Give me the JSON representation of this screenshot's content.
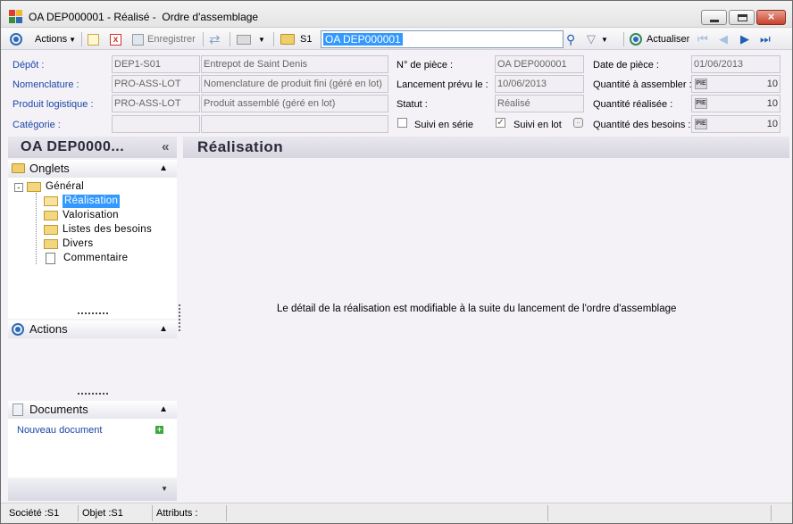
{
  "window": {
    "title": "OA DEP000001 - Réalisé -  Ordre d'assemblage",
    "close_glyph": "×"
  },
  "toolbar": {
    "actions_label": "Actions",
    "save_label": "Enregistrer",
    "s1_label": "S1",
    "search_value": "OA DEP000001",
    "refresh_label": "Actualiser"
  },
  "header": {
    "depot_label": "Dépôt :",
    "depot_code": "DEP1-S01",
    "depot_name": "Entrepot de  Saint  Denis",
    "nomenclature_label": "Nomenclature :",
    "nomenclature_code": "PRO-ASS-LOT",
    "nomenclature_name": "Nomenclature de produit fini (géré en lot)",
    "produit_label": "Produit logistique :",
    "produit_code": "PRO-ASS-LOT",
    "produit_name": "Produit assemblé (géré en lot)",
    "categorie_label": "Catégorie :",
    "categorie_code": "",
    "categorie_name": "",
    "piece_label": "N° de pièce :",
    "piece_value": "OA DEP000001",
    "lancement_label": "Lancement prévu le :",
    "lancement_value": "10/06/2013",
    "statut_label": "Statut :",
    "statut_value": "Réalisé",
    "suivi_serie_label": "Suivi en série",
    "suivi_lot_label": "Suivi en lot",
    "date_piece_label": "Date de pièce :",
    "date_piece_value": "01/06/2013",
    "qte_assembler_label": "Quantité à assembler :",
    "qte_assembler_value": "10",
    "qte_realisee_label": "Quantité réalisée :",
    "qte_realisee_value": "10",
    "qte_besoins_label": "Quantité des besoins :",
    "qte_besoins_value": "10",
    "pie_badge": "PIE",
    "checkmark": "✓"
  },
  "left_panel": {
    "title": "OA DEP0000...",
    "collapse_glyph": "«",
    "onglets_label": "Onglets",
    "tree": [
      {
        "label": "Général"
      },
      {
        "label": "Réalisation"
      },
      {
        "label": "Valorisation"
      },
      {
        "label": "Listes des besoins"
      },
      {
        "label": "Divers"
      },
      {
        "label": "Commentaire"
      }
    ],
    "actions_label": "Actions",
    "documents_label": "Documents",
    "new_document_label": "Nouveau document"
  },
  "content": {
    "title": "Réalisation",
    "message": "Le détail de la réalisation est modifiable à la suite du lancement de l'ordre d'assemblage"
  },
  "statusbar": {
    "societe": "Société :S1",
    "objet": "Objet :S1",
    "attributs": "Attributs :"
  },
  "colors": {
    "accent": "#1a46a8",
    "selection": "#3399ff"
  }
}
